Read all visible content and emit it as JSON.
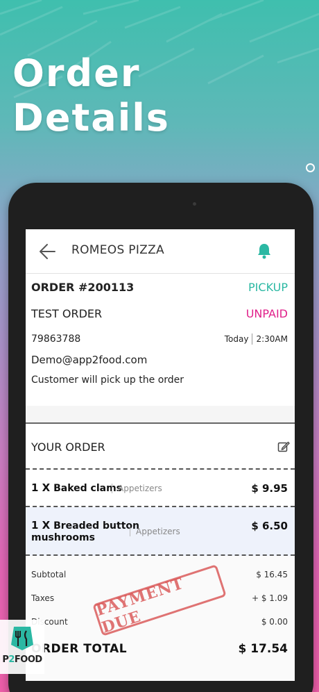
{
  "banner": {
    "headline_line1": "Order",
    "headline_line2": "Details"
  },
  "header": {
    "title": "ROMEOS PIZZA"
  },
  "order": {
    "number": "ORDER #200113",
    "type": "PICKUP",
    "label": "TEST ORDER",
    "payment_status": "UNPAID",
    "phone": "79863788",
    "date": "Today",
    "time": "2:30AM",
    "email": "Demo@app2food.com",
    "note": "Customer will pick up the order"
  },
  "your_order": {
    "title": "YOUR ORDER"
  },
  "items": [
    {
      "qty": "1 X",
      "name": "Baked clams",
      "category": "Appetizers",
      "price": "$ 9.95"
    },
    {
      "qty": "1 X",
      "name_line1": "Breaded button",
      "name_line2": "mushrooms",
      "category": "Appetizers",
      "price": "$ 6.50"
    }
  ],
  "totals": {
    "subtotal_label": "Subtotal",
    "subtotal": "$ 16.45",
    "taxes_label": "Taxes",
    "taxes": "+ $ 1.09",
    "discount_label": "Discount",
    "discount": "$ 0.00",
    "total_label": "ORDER TOTAL",
    "total": "$ 17.54"
  },
  "stamp": {
    "text": "PAYMENT DUE"
  },
  "logo": {
    "text_pre": "P",
    "text_two": "2",
    "text_post": "FOOD"
  },
  "colors": {
    "accent_teal": "#2bb8a3",
    "unpaid_pink": "#e0208a",
    "stamp_red": "#d64646"
  },
  "icons": {
    "back": "arrow-left-icon",
    "bell": "bell-icon",
    "edit": "edit-icon"
  }
}
